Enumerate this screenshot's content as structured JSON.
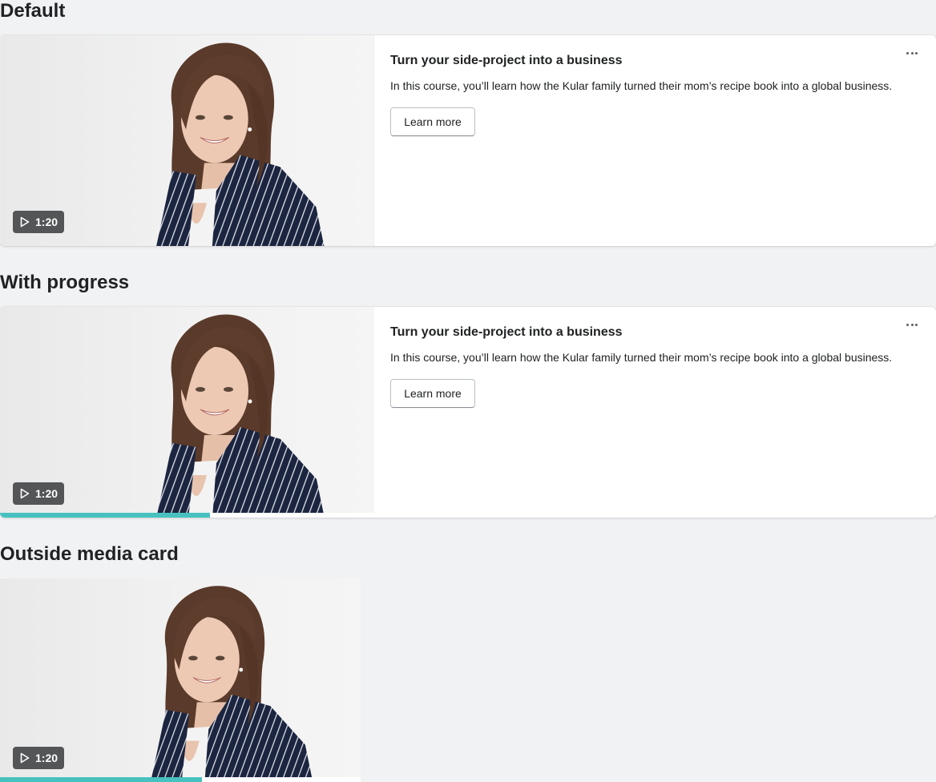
{
  "sections": [
    {
      "heading": "Default",
      "card": {
        "title": "Turn your side-project into a business",
        "description": "In this course, you’ll learn how the Kular family turned their mom’s recipe book into a global business.",
        "button_label": "Learn more",
        "duration": "1:20",
        "more_icon": "horizontal-dots-icon",
        "play_icon": "play-icon"
      }
    },
    {
      "heading": "With progress",
      "card": {
        "title": "Turn your side-project into a business",
        "description": "In this course, you’ll learn how the Kular family turned their mom’s recipe book into a global business.",
        "button_label": "Learn more",
        "duration": "1:20",
        "progress_fraction": 0.56,
        "more_icon": "horizontal-dots-icon",
        "play_icon": "play-icon"
      }
    },
    {
      "heading": "Outside media card",
      "card": {
        "duration": "1:20",
        "progress_fraction": 0.56,
        "play_icon": "play-icon"
      }
    }
  ],
  "colors": {
    "page_background": "#f1f2f4",
    "progress_fill": "#47c1bf",
    "badge_background": "#46484a"
  }
}
